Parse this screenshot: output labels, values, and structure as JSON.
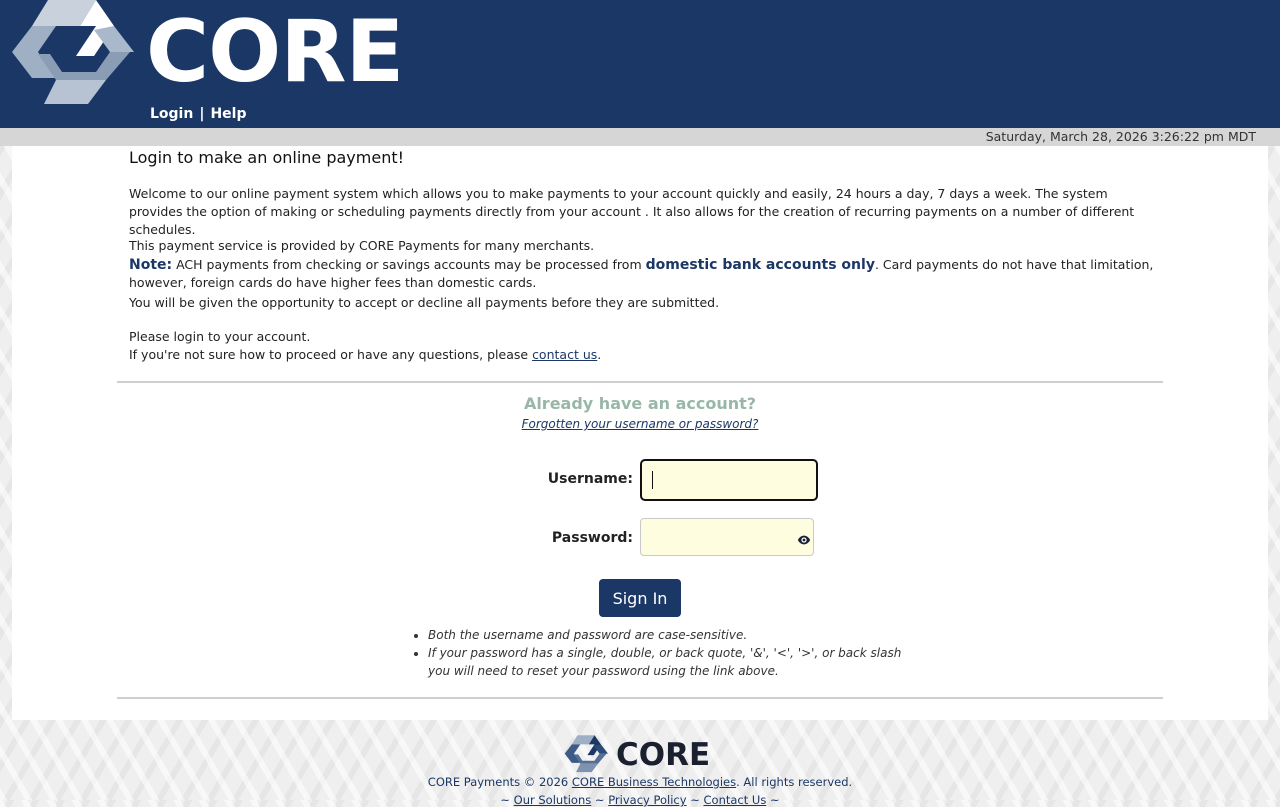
{
  "brand": {
    "logo_text": "CORE",
    "color_primary": "#1b3766",
    "color_accent": "#98b7a8"
  },
  "nav": {
    "login": "Login",
    "separator": "|",
    "help": "Help"
  },
  "datetime": "Saturday, March 28, 2026 3:26:22 pm MDT",
  "intro": {
    "title": "Login to make an online payment!",
    "welcome": "Welcome to our online payment system which allows you to make payments to your account quickly and easily, 24 hours a day, 7 days a week.  The system provides the option of making or scheduling payments directly from your account .  It also allows for the creation of recurring payments on a number of different schedules.",
    "provided_by": "This payment service is provided by CORE Payments for many merchants.",
    "note_label": "Note:",
    "note_part1": " ACH payments from checking or savings accounts may be processed from ",
    "note_emphasis": "domestic bank accounts only",
    "note_part2": ". Card payments do not have that limitation, however, foreign cards do have higher fees than domestic cards.",
    "accept_decline": "You will be given the opportunity to accept or decline all payments before they are submitted.",
    "please_login": "Please login to your account.",
    "questions_prefix": "If you're not sure how to proceed or have any questions, please ",
    "contact_link": "contact us",
    "questions_suffix": "."
  },
  "login": {
    "heading": "Already have an account?",
    "forgot_link": "Forgotten your username or password?",
    "username_label": "Username:",
    "username_value": "",
    "password_label": "Password:",
    "password_value": "",
    "show_password_icon": "eye-icon",
    "sign_in": "Sign In",
    "hints": [
      "Both the username and password are case-sensitive.",
      "If your password has a single, double, or back quote, '&', '<', '>', or back slash you will need to reset your password using the link above."
    ]
  },
  "footer": {
    "logo_text": "CORE",
    "copyright_prefix": "CORE Payments © 2026 ",
    "company_link": "CORE Business Technologies",
    "copyright_suffix": ". All rights reserved.",
    "links_prefix": "~ ",
    "our_solutions": "Our Solutions",
    "privacy_policy": "Privacy Policy",
    "contact_us": "Contact Us",
    "link_sep": " ~ ",
    "links_suffix": " ~"
  }
}
